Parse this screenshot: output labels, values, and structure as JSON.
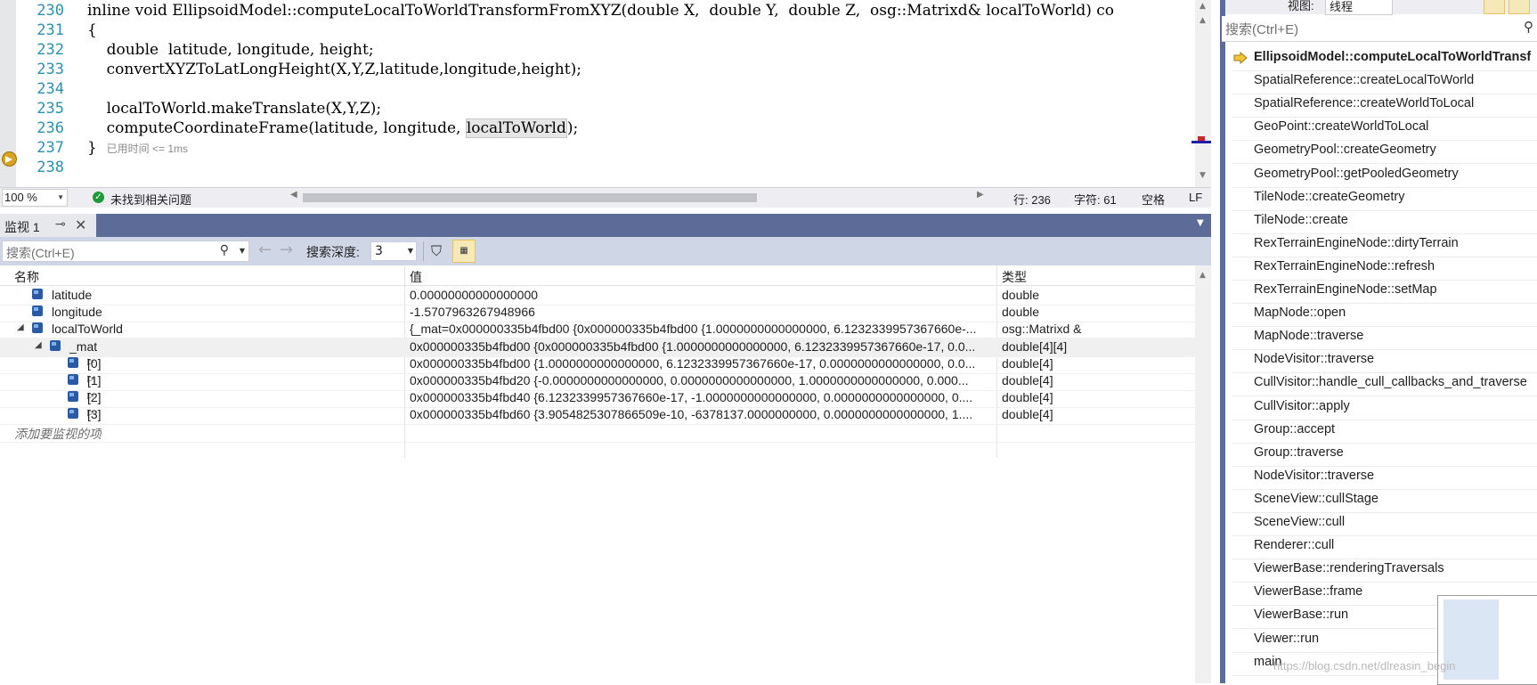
{
  "editor": {
    "lines": [
      {
        "num": "230",
        "text": "inline void EllipsoidModel::computeLocalToWorldTransformFromXYZ(double X,  double Y,  double Z,  osg::Matrixd& localToWorld) co"
      },
      {
        "num": "231",
        "text": "{"
      },
      {
        "num": "232",
        "text": "    double  latitude, longitude, height;"
      },
      {
        "num": "233",
        "text": "    convertXYZToLatLongHeight(X,Y,Z,latitude,longitude,height);"
      },
      {
        "num": "234",
        "text": ""
      },
      {
        "num": "235",
        "text": "    localToWorld.makeTranslate(X,Y,Z);"
      },
      {
        "num": "236",
        "text": "    computeCoordinateFrame(latitude, longitude, "
      },
      {
        "num": "237",
        "text": "}"
      },
      {
        "num": "238",
        "text": ""
      }
    ],
    "highlight_token": "localToWorld",
    "line236_tail": ");",
    "elapsed": "已用时间 <= 1ms"
  },
  "status": {
    "zoom": "100 %",
    "issues": "未找到相关问题",
    "line": "行: 236",
    "char": "字符: 61",
    "whitespace": "空格",
    "eol": "LF"
  },
  "watch": {
    "tab_title": "监视 1",
    "search_placeholder": "搜索(Ctrl+E)",
    "depth_label": "搜索深度:",
    "depth_value": "3",
    "columns": {
      "name": "名称",
      "value": "值",
      "type": "类型"
    },
    "rows": [
      {
        "name": "latitude",
        "value": "0.00000000000000000",
        "type": "double",
        "indent": 0,
        "expander": "",
        "selected": false
      },
      {
        "name": "longitude",
        "value": "-1.5707963267948966",
        "type": "double",
        "indent": 0,
        "expander": "",
        "selected": false
      },
      {
        "name": "localToWorld",
        "value": "{_mat=0x000000335b4fbd00 {0x000000335b4fbd00 {1.0000000000000000, 6.1232339957367660e-...",
        "type": "osg::Matrixd &",
        "indent": 0,
        "expander": "◢",
        "selected": false
      },
      {
        "name": "_mat",
        "value": "0x000000335b4fbd00 {0x000000335b4fbd00 {1.0000000000000000, 6.1232339957367660e-17, 0.0...",
        "type": "double[4][4]",
        "indent": 1,
        "expander": "◢",
        "selected": true
      },
      {
        "name": "[0]",
        "value": "0x000000335b4fbd00 {1.0000000000000000, 6.1232339957367660e-17, 0.0000000000000000, 0.0...",
        "type": "double[4]",
        "indent": 2,
        "expander": "▷",
        "selected": false
      },
      {
        "name": "[1]",
        "value": "0x000000335b4fbd20 {-0.0000000000000000, 0.0000000000000000, 1.0000000000000000, 0.000...",
        "type": "double[4]",
        "indent": 2,
        "expander": "▷",
        "selected": false
      },
      {
        "name": "[2]",
        "value": "0x000000335b4fbd40 {6.1232339957367660e-17, -1.0000000000000000, 0.0000000000000000, 0....",
        "type": "double[4]",
        "indent": 2,
        "expander": "▷",
        "selected": false
      },
      {
        "name": "[3]",
        "value": "0x000000335b4fbd60 {3.9054825307866509e-10, -6378137.0000000000, 0.0000000000000000, 1....",
        "type": "double[4]",
        "indent": 2,
        "expander": "▷",
        "selected": false
      }
    ],
    "add_placeholder": "添加要监视的项"
  },
  "callstack": {
    "view_label": "视图:",
    "view_value": "线程",
    "search_placeholder": "搜索(Ctrl+E)",
    "frames": [
      "EllipsoidModel::computeLocalToWorldTransf",
      "SpatialReference::createLocalToWorld",
      "SpatialReference::createWorldToLocal",
      "GeoPoint::createWorldToLocal",
      "GeometryPool::createGeometry",
      "GeometryPool::getPooledGeometry",
      "TileNode::createGeometry",
      "TileNode::create",
      "RexTerrainEngineNode::dirtyTerrain",
      "RexTerrainEngineNode::refresh",
      "RexTerrainEngineNode::setMap",
      "MapNode::open",
      "MapNode::traverse",
      "NodeVisitor::traverse",
      "CullVisitor::handle_cull_callbacks_and_traverse",
      "CullVisitor::apply",
      "Group::accept",
      "Group::traverse",
      "NodeVisitor::traverse",
      "SceneView::cullStage",
      "SceneView::cull",
      "Renderer::cull",
      "ViewerBase::renderingTraversals",
      "ViewerBase::frame",
      "ViewerBase::run",
      "Viewer::run",
      "main"
    ]
  },
  "watermark": "https://blog.csdn.net/dlreasin_begin",
  "colors": {
    "accent": "#5d6b99",
    "line_number": "#2b91af",
    "toolbar": "#cfd6e5",
    "ok": "#1f9a3a",
    "breakpoint": "#d9a322"
  }
}
